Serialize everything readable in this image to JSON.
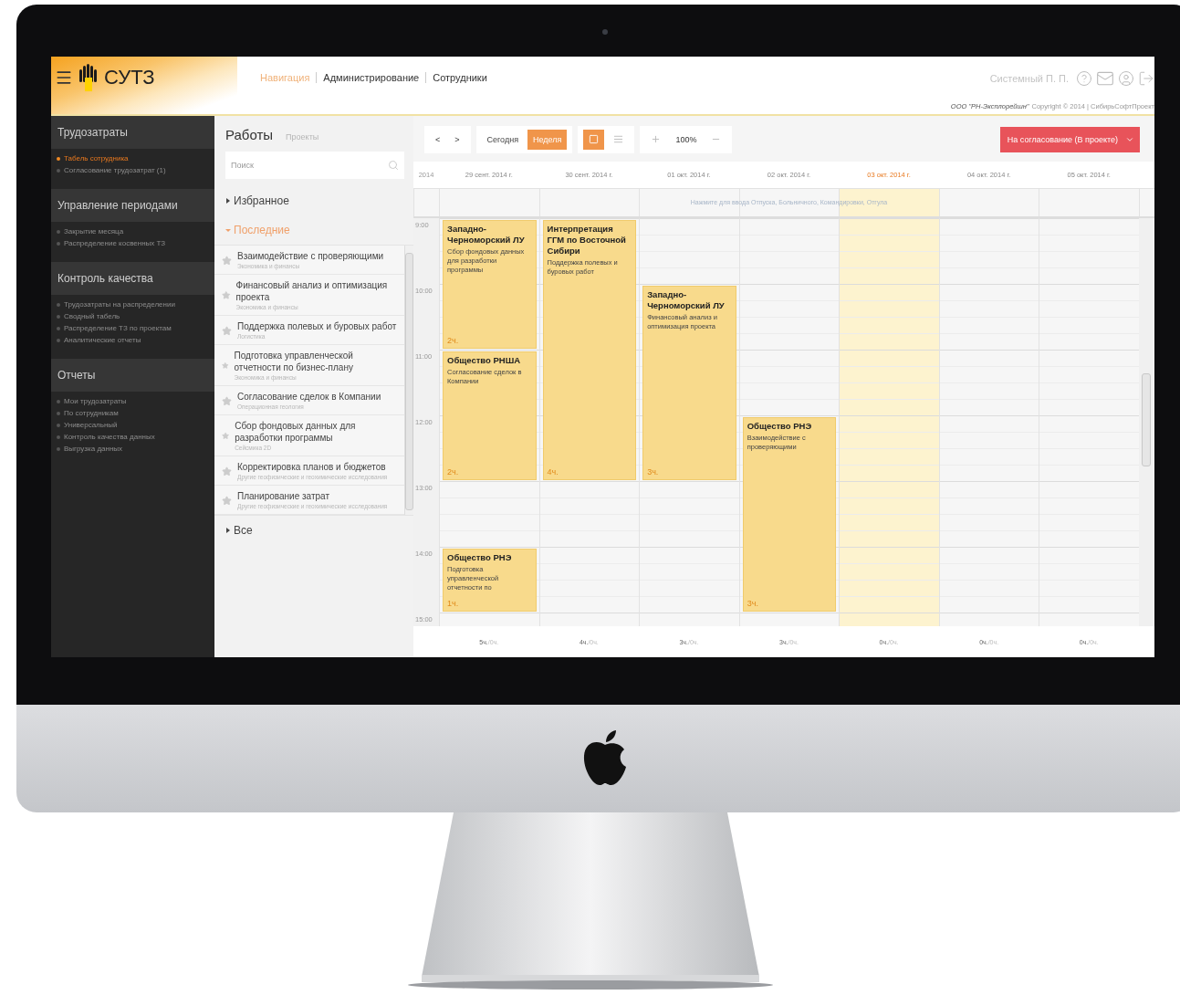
{
  "header": {
    "logo": "СУТЗ",
    "nav": [
      {
        "label": "Навигация",
        "selected": true
      },
      {
        "label": "Администрирование",
        "selected": false
      },
      {
        "label": "Сотрудники",
        "selected": false
      }
    ],
    "user": "Системный П. П.",
    "company": "ООО \"РН-Эксплорейшн\"",
    "copyright": "Copyright © 2014 | СибирьСофтПроект"
  },
  "sidebar": [
    {
      "title": "Трудозатраты",
      "items": [
        {
          "label": "Табель сотрудника",
          "selected": true
        },
        {
          "label": "Согласование трудозатрат (1)",
          "selected": false
        }
      ]
    },
    {
      "title": "Управление периодами",
      "items": [
        {
          "label": "Закрытие месяца",
          "selected": false
        },
        {
          "label": "Распределение косвенных ТЗ",
          "selected": false
        }
      ]
    },
    {
      "title": "Контроль качества",
      "items": [
        {
          "label": "Трудозатраты на распределении",
          "selected": false
        },
        {
          "label": "Сводный табель",
          "selected": false
        },
        {
          "label": "Распределение ТЗ по проектам",
          "selected": false
        },
        {
          "label": "Аналитические отчеты",
          "selected": false
        }
      ]
    },
    {
      "title": "Отчеты",
      "items": [
        {
          "label": "Мои трудозатраты",
          "selected": false
        },
        {
          "label": "По сотрудникам",
          "selected": false
        },
        {
          "label": "Универсальный",
          "selected": false
        },
        {
          "label": "Контроль качества данных",
          "selected": false
        },
        {
          "label": "Выгрузка данных",
          "selected": false
        }
      ]
    }
  ],
  "works": {
    "tabs": [
      {
        "label": "Работы",
        "selected": true
      },
      {
        "label": "Проекты",
        "selected": false
      }
    ],
    "search": {
      "placeholder": "Поиск"
    },
    "groups": [
      {
        "label": "Избранное",
        "expanded": false
      },
      {
        "label": "Последние",
        "expanded": true,
        "items": [
          {
            "title": "Взаимодействие с проверяющими",
            "subtitle": "Экономика и финансы"
          },
          {
            "title": "Финансовый анализ и оптимизация проекта",
            "subtitle": "Экономика и финансы"
          },
          {
            "title": "Поддержка полевых и буровых работ",
            "subtitle": "Логистика"
          },
          {
            "title": "Подготовка управленческой отчетности по бизнес-плану",
            "subtitle": "Экономика и финансы"
          },
          {
            "title": "Согласование сделок в Компании",
            "subtitle": "Операционная геология"
          },
          {
            "title": "Сбор фондовых данных для разработки программы",
            "subtitle": "Сейсмика 2D"
          },
          {
            "title": "Корректировка планов и бюджетов",
            "subtitle": "Другие геофизические и геохимические исследования"
          },
          {
            "title": "Планирование затрат",
            "subtitle": "Другие геофизические и геохимические исследования"
          }
        ]
      },
      {
        "label": "Все",
        "expanded": false
      }
    ]
  },
  "calendar": {
    "prev": "<",
    "next": ">",
    "today": "Сегодня",
    "week": {
      "label": "Неделя",
      "selected": true
    },
    "views": [
      {
        "kind": "calendar",
        "selected": true
      },
      {
        "kind": "list",
        "selected": false
      }
    ],
    "zoom": "100%",
    "submit": "На согласование (В проекте)",
    "year": "2014",
    "hint": "Нажмите для ввода Отпуска, Больничного, Командировки, Отгула",
    "times": [
      "9:00",
      "10:00",
      "11:00",
      "12:00",
      "13:00",
      "14:00",
      "15:00"
    ],
    "days": [
      {
        "label": "29 сент. 2014 г.",
        "selected": false,
        "total": "5ч.",
        "planned": "/0ч.",
        "slots": [
          {
            "kind": "event",
            "title": "Западно-Черноморский ЛУ",
            "subtitle": "Сбор фондовых данных для разработки программы",
            "hours": "2ч."
          },
          {
            "kind": "continued"
          },
          {
            "kind": "event",
            "title": "Общество РНША",
            "subtitle": "Согласование сделок в Компании",
            "hours": "2ч."
          },
          {
            "kind": "continued"
          },
          {
            "kind": "empty"
          },
          {
            "kind": "event",
            "title": "Общество РНЭ",
            "subtitle": "Подготовка управленческой отчетности по",
            "hours": "1ч."
          }
        ]
      },
      {
        "label": "30 сент. 2014 г.",
        "selected": false,
        "total": "4ч.",
        "planned": "/0ч.",
        "slots": [
          {
            "kind": "event",
            "title": "Интерпретация ГГМ по Восточной Сибири",
            "subtitle": "Поддержка полевых и буровых работ",
            "hours": "4ч."
          },
          {
            "kind": "continued"
          },
          {
            "kind": "continued"
          },
          {
            "kind": "continued"
          }
        ]
      },
      {
        "label": "01 окт. 2014 г.",
        "selected": false,
        "total": "3ч.",
        "planned": "/0ч.",
        "slots": [
          {
            "kind": "empty"
          },
          {
            "kind": "event",
            "title": "Западно-Черноморский ЛУ",
            "subtitle": "Финансовый анализ и оптимизация проекта",
            "hours": "3ч."
          },
          {
            "kind": "continued"
          },
          {
            "kind": "continued"
          }
        ]
      },
      {
        "label": "02 окт. 2014 г.",
        "selected": false,
        "total": "3ч.",
        "planned": "/0ч.",
        "slots": [
          {
            "kind": "empty"
          },
          {
            "kind": "empty"
          },
          {
            "kind": "empty"
          },
          {
            "kind": "event",
            "title": "Общество РНЭ",
            "subtitle": "Взаимодействие с проверяющими",
            "hours": "3ч."
          },
          {
            "kind": "continued"
          },
          {
            "kind": "continued"
          }
        ]
      },
      {
        "label": "03 окт. 2014 г.",
        "selected": true,
        "total": "0ч.",
        "planned": "/0ч."
      },
      {
        "label": "04 окт. 2014 г.",
        "selected": false,
        "total": "0ч.",
        "planned": "/0ч."
      },
      {
        "label": "05 окт. 2014 г.",
        "selected": false,
        "total": "0ч.",
        "planned": "/0ч."
      }
    ]
  }
}
